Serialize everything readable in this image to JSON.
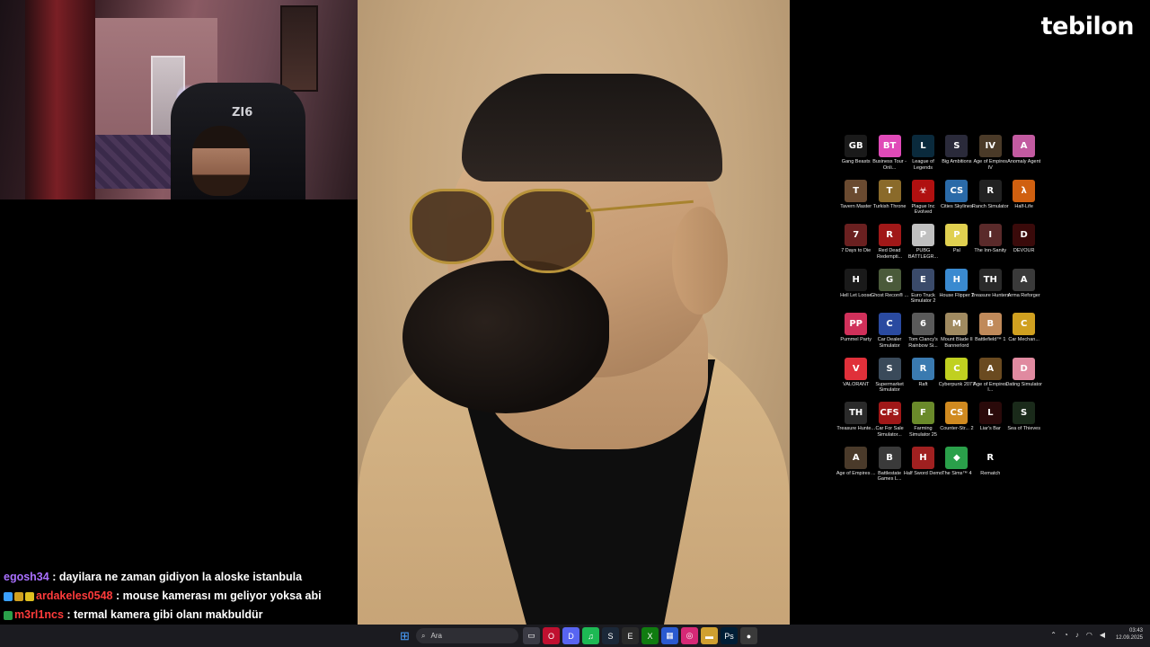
{
  "logo": "tebilon",
  "desktop_icons": [
    {
      "label": "Gang Beasts",
      "icon": "gang-beasts-icon",
      "color": "#1a1a1a",
      "glyph": "GB"
    },
    {
      "label": "Business Tour - Onli...",
      "icon": "business-tour-icon",
      "color": "#e04ab8",
      "glyph": "BT"
    },
    {
      "label": "League of Legends",
      "icon": "league-of-legends-icon",
      "color": "#0a2a3c",
      "glyph": "L"
    },
    {
      "label": "Big Ambitions",
      "icon": "big-ambitions-icon",
      "color": "#2a2a3a",
      "glyph": "S"
    },
    {
      "label": "Age of Empires IV",
      "icon": "age-of-empires-4-icon",
      "color": "#4a3a28",
      "glyph": "IV"
    },
    {
      "label": "Anomaly Agent",
      "icon": "anomaly-agent-icon",
      "color": "#c25aa0",
      "glyph": "A"
    },
    {
      "label": "Tavern Master",
      "icon": "tavern-master-icon",
      "color": "#6a4a30",
      "glyph": "T"
    },
    {
      "label": "Turkish Throne",
      "icon": "turkish-throne-icon",
      "color": "#8a6a2a",
      "glyph": "T"
    },
    {
      "label": "Plague Inc Evolved",
      "icon": "plague-inc-icon",
      "color": "#b01010",
      "glyph": "☣"
    },
    {
      "label": "Cities Skylines",
      "icon": "cities-skylines-icon",
      "color": "#2a6aa8",
      "glyph": "CS"
    },
    {
      "label": "Ranch Simulator",
      "icon": "ranch-simulator-icon",
      "color": "#222222",
      "glyph": "R"
    },
    {
      "label": "Half-Life",
      "icon": "half-life-icon",
      "color": "#d06010",
      "glyph": "λ"
    },
    {
      "label": "7 Days to Die",
      "icon": "7-days-to-die-icon",
      "color": "#6a2020",
      "glyph": "7"
    },
    {
      "label": "Red Dead Redempti...",
      "icon": "red-dead-redemption-icon",
      "color": "#a01818",
      "glyph": "R"
    },
    {
      "label": "PUBG BATTLEGR...",
      "icon": "pubg-icon",
      "color": "#c0c0c0",
      "glyph": "P"
    },
    {
      "label": "Pal",
      "icon": "pal-icon",
      "color": "#e0d050",
      "glyph": "P"
    },
    {
      "label": "The Inn-Sanity",
      "icon": "inn-sanity-icon",
      "color": "#5a2a2a",
      "glyph": "I"
    },
    {
      "label": "DEVOUR",
      "icon": "devour-icon",
      "color": "#3a0a0a",
      "glyph": "D"
    },
    {
      "label": "Hell Let Loose",
      "icon": "hell-let-loose-icon",
      "color": "#1a1a1a",
      "glyph": "H"
    },
    {
      "label": "Ghost Recon® ...",
      "icon": "ghost-recon-icon",
      "color": "#4a5a3a",
      "glyph": "G"
    },
    {
      "label": "Euro Truck Simulator 2",
      "icon": "euro-truck-icon",
      "color": "#3a4a6a",
      "glyph": "E"
    },
    {
      "label": "House Flipper 2",
      "icon": "house-flipper-icon",
      "color": "#3a8ad0",
      "glyph": "H"
    },
    {
      "label": "Treasure Hunters",
      "icon": "treasure-hunters-icon",
      "color": "#2a2a2a",
      "glyph": "TH"
    },
    {
      "label": "Arma Reforger",
      "icon": "arma-reforger-icon",
      "color": "#3a3a3a",
      "glyph": "A"
    },
    {
      "label": "Pummel Party",
      "icon": "pummel-party-icon",
      "color": "#d0305a",
      "glyph": "PP"
    },
    {
      "label": "Car Dealer Simulator",
      "icon": "car-dealer-icon",
      "color": "#2a4aa0",
      "glyph": "C"
    },
    {
      "label": "Tom Clancy's Rainbow Si...",
      "icon": "rainbow-six-icon",
      "color": "#5a5a5a",
      "glyph": "6"
    },
    {
      "label": "Mount Blade II Bannerlord",
      "icon": "bannerlord-icon",
      "color": "#a08a60",
      "glyph": "M"
    },
    {
      "label": "Battlefield™ 1",
      "icon": "battlefield-icon",
      "color": "#c08a5a",
      "glyph": "B"
    },
    {
      "label": "Car Mechan...",
      "icon": "car-mechanic-icon",
      "color": "#d0a020",
      "glyph": "C"
    },
    {
      "label": "VALORANT",
      "icon": "valorant-icon",
      "color": "#e0303a",
      "glyph": "V"
    },
    {
      "label": "Supermarket Simulator",
      "icon": "supermarket-simulator-icon",
      "color": "#3a4a5a",
      "glyph": "S"
    },
    {
      "label": "Raft",
      "icon": "raft-icon",
      "color": "#3a7ab0",
      "glyph": "R"
    },
    {
      "label": "Cyberpunk 2077",
      "icon": "cyberpunk-icon",
      "color": "#c0d020",
      "glyph": "C"
    },
    {
      "label": "Age of Empires I...",
      "icon": "age-of-empires-icon",
      "color": "#6a4a20",
      "glyph": "A"
    },
    {
      "label": "Dating Simulator",
      "icon": "dating-simulator-icon",
      "color": "#e08aa0",
      "glyph": "D"
    },
    {
      "label": "Treasure Hunte...",
      "icon": "treasure-hunter-icon",
      "color": "#2a2a2a",
      "glyph": "TH"
    },
    {
      "label": "Car For Sale Simulator...",
      "icon": "car-for-sale-icon",
      "color": "#a01818",
      "glyph": "CFS"
    },
    {
      "label": "Farming Simulator 25",
      "icon": "farming-simulator-icon",
      "color": "#6a8a2a",
      "glyph": "F"
    },
    {
      "label": "Counter-Str... 2",
      "icon": "counter-strike-icon",
      "color": "#d08a20",
      "glyph": "CS"
    },
    {
      "label": "Liar's Bar",
      "icon": "liars-bar-icon",
      "color": "#2a0a0a",
      "glyph": "L"
    },
    {
      "label": "Sea of Thieves",
      "icon": "sea-of-thieves-icon",
      "color": "#1a2a1a",
      "glyph": "S"
    },
    {
      "label": "Age of Empires ...",
      "icon": "age-of-empires-2-icon",
      "color": "#4a3a2a",
      "glyph": "A"
    },
    {
      "label": "Battlestate Games L...",
      "icon": "battlestate-games-icon",
      "color": "#3a3a3a",
      "glyph": "B"
    },
    {
      "label": "Half Sword Demo",
      "icon": "half-sword-icon",
      "color": "#a02020",
      "glyph": "H"
    },
    {
      "label": "The Sims™ 4",
      "icon": "the-sims-icon",
      "color": "#2aa04a",
      "glyph": "◆"
    },
    {
      "label": "Rematch",
      "icon": "rematch-icon",
      "color": "#000000",
      "glyph": "R"
    }
  ],
  "chat": [
    {
      "user": "egosh34",
      "text": " : dayilara ne zaman gidiyon la aloske istanbula",
      "user_color": "purple"
    },
    {
      "user": "ardakeles0548",
      "text": " : mouse kamerası mı geliyor yoksa abi",
      "user_color": "red"
    },
    {
      "user": "m3rl1ncs",
      "text": " : termal kamera gibi olanı makbuldür",
      "user_color": "red"
    }
  ],
  "webcam": {
    "chair_brand": "ZI6"
  },
  "taskbar": {
    "search_placeholder": "Ara",
    "apps": [
      {
        "icon": "task-view-icon",
        "color": "#3a3a44",
        "glyph": "▭"
      },
      {
        "icon": "opera-icon",
        "color": "#c01030",
        "glyph": "O"
      },
      {
        "icon": "discord-icon",
        "color": "#5865f2",
        "glyph": "D"
      },
      {
        "icon": "spotify-icon",
        "color": "#1db954",
        "glyph": "♫"
      },
      {
        "icon": "steam-icon",
        "color": "#1b2838",
        "glyph": "S"
      },
      {
        "icon": "epic-games-icon",
        "color": "#2a2a2a",
        "glyph": "E"
      },
      {
        "icon": "xbox-icon",
        "color": "#107c10",
        "glyph": "X"
      },
      {
        "icon": "microsoft-store-icon",
        "color": "#2a5ad0",
        "glyph": "▦"
      },
      {
        "icon": "instagram-icon",
        "color": "#d62976",
        "glyph": "◎"
      },
      {
        "icon": "file-explorer-icon",
        "color": "#d0a030",
        "glyph": "▬"
      },
      {
        "icon": "photoshop-icon",
        "color": "#001e36",
        "glyph": "Ps"
      },
      {
        "icon": "obs-icon",
        "color": "#3a3a3a",
        "glyph": "●"
      }
    ],
    "time": "03:43",
    "date": "12.09.2025"
  }
}
